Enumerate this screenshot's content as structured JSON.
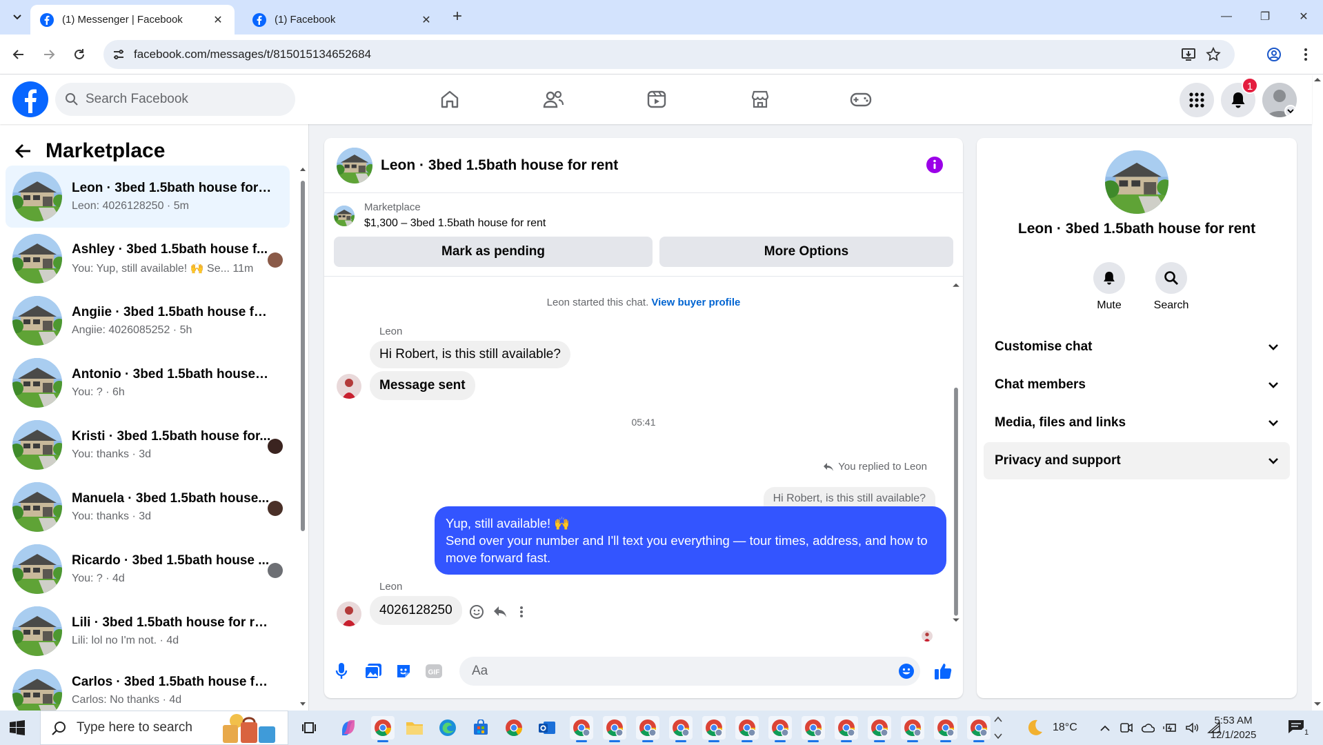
{
  "browser": {
    "tabs": [
      {
        "title": "(1) Messenger | Facebook",
        "active": true
      },
      {
        "title": "(1) Facebook",
        "active": false
      }
    ],
    "url": "facebook.com/messages/t/815015134652684"
  },
  "header": {
    "search_placeholder": "Search Facebook",
    "notification_count": "1",
    "nav": [
      "home-icon",
      "friends-icon",
      "video-icon",
      "marketplace-icon",
      "gaming-icon"
    ]
  },
  "sidebar": {
    "title": "Marketplace",
    "conversations": [
      {
        "name": "Leon · 3bed 1.5bath house for rent",
        "preview": "Leon: 4026128250 · 5m",
        "selected": true
      },
      {
        "name": "Ashley · 3bed 1.5bath house f...",
        "preview": "You: Yup, still available! 🙌 Se...   11m"
      },
      {
        "name": "Angiie · 3bed 1.5bath house for ...",
        "preview": "Angiie: 4026085252 · 5h"
      },
      {
        "name": "Antonio · 3bed 1.5bath house fo...",
        "preview": "You: ? · 6h"
      },
      {
        "name": "Kristi · 3bed 1.5bath house for...",
        "preview": "You: thanks · 3d"
      },
      {
        "name": "Manuela · 3bed 1.5bath house...",
        "preview": "You: thanks · 3d"
      },
      {
        "name": "Ricardo · 3bed 1.5bath house ...",
        "preview": "You: ? · 4d"
      },
      {
        "name": "Lili · 3bed 1.5bath house for rent",
        "preview": "Lili: lol no I'm not. · 4d"
      },
      {
        "name": "Carlos · 3bed 1.5bath house for r...",
        "preview": "Carlos: No thanks · 4d"
      }
    ]
  },
  "chat": {
    "title": "Leon · 3bed 1.5bath house for rent",
    "listing_source": "Marketplace",
    "listing_text": "$1,300 – 3bed 1.5bath house for rent",
    "mark_pending": "Mark as pending",
    "more_options": "More Options",
    "started_text": "Leon started this chat.",
    "buyer_profile_link": "View buyer profile",
    "sender_name": "Leon",
    "msg1": "Hi Robert, is this still available?",
    "msg2": "Message sent",
    "timestamp": "05:41",
    "replied_to": "You replied to Leon",
    "quoted": "Hi Robert, is this still available?",
    "my_reply_line1": "Yup, still available! 🙌",
    "my_reply_line2": "Send over your number and I'll text you everything — tour times, address, and how to move forward fast.",
    "sender_name2": "Leon",
    "msg3": "4026128250",
    "composer_placeholder": "Aa"
  },
  "details": {
    "title": "Leon · 3bed 1.5bath house for rent",
    "mute": "Mute",
    "search": "Search",
    "rows": [
      "Customise chat",
      "Chat members",
      "Media, files and links",
      "Privacy and support"
    ]
  },
  "taskbar": {
    "search_placeholder": "Type here to search",
    "temperature": "18°C",
    "time": "5:53 AM",
    "date": "12/1/2025",
    "notification_count": "1"
  },
  "colors": {
    "fb_blue": "#0866ff",
    "my_bubble": "#3355ff",
    "info": "#9b00e8"
  }
}
